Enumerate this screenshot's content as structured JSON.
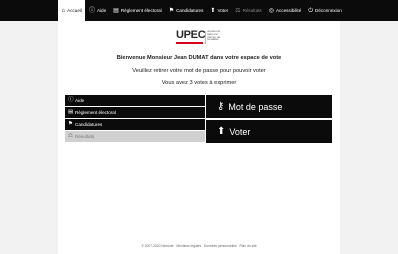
{
  "nav": {
    "items": [
      {
        "label": "Accueil",
        "icon": "home-icon",
        "glyph": "⌂",
        "active": true,
        "disabled": false
      },
      {
        "label": "Aide",
        "icon": "help-icon",
        "glyph": "ⓘ",
        "active": false,
        "disabled": false
      },
      {
        "label": "Règlement électoral",
        "icon": "document-icon",
        "glyph": "▤",
        "active": false,
        "disabled": false
      },
      {
        "label": "Candidatures",
        "icon": "people-icon",
        "glyph": "⚑",
        "active": false,
        "disabled": false
      },
      {
        "label": "Voter",
        "icon": "vote-icon",
        "glyph": "⬆",
        "active": false,
        "disabled": false
      },
      {
        "label": "Résultats",
        "icon": "results-icon",
        "glyph": "⚖",
        "active": false,
        "disabled": true
      },
      {
        "label": "Accessibilité",
        "icon": "accessibility-icon",
        "glyph": "◎",
        "active": false,
        "disabled": false
      },
      {
        "label": "Déconnexion",
        "icon": "logout-icon",
        "glyph": "⏻",
        "active": false,
        "disabled": false
      }
    ]
  },
  "logo": {
    "mark": "UPEC",
    "sub": "UNIVERSITÉ PARIS-EST CRÉTEIL VAL DE MARNE",
    "accent": "#d6001c"
  },
  "welcome": {
    "line1": "Bienvenue Monsieur Jean DUMAT dans votre espace de vote",
    "line2": "Veuillez retirer votre mot de passe pour pouvoir voter",
    "line3": "Vous avez 3 votes à exprimer"
  },
  "menu": {
    "items": [
      {
        "label": "Aide",
        "icon": "help-icon",
        "glyph": "ⓘ",
        "disabled": false
      },
      {
        "label": "Règlement électoral",
        "icon": "document-icon",
        "glyph": "▤",
        "disabled": false
      },
      {
        "label": "Candidatures",
        "icon": "people-icon",
        "glyph": "⚑",
        "disabled": false
      },
      {
        "label": "Résultats",
        "icon": "results-icon",
        "glyph": "⚖",
        "disabled": true
      }
    ]
  },
  "actions": {
    "password": {
      "label": "Mot de passe",
      "icon": "key-icon",
      "glyph": "⚷"
    },
    "vote": {
      "label": "Voter",
      "icon": "vote-icon",
      "glyph": "⬆"
    }
  },
  "footer": {
    "copyright": "© 2007-2020 Neovote",
    "links": [
      "Mentions légales",
      "Données personnelles",
      "Plan du site"
    ]
  }
}
